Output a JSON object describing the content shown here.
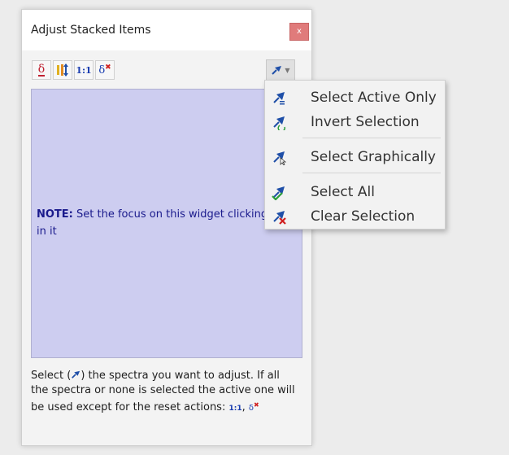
{
  "window": {
    "title": "Adjust Stacked Items",
    "close_label": "x"
  },
  "toolbar": {
    "buttons": [
      {
        "icon": "delta-underline-icon",
        "label": "δ"
      },
      {
        "icon": "align-stack-icon",
        "label": ""
      },
      {
        "icon": "one-to-one-icon",
        "label": "1:1"
      },
      {
        "icon": "delta-reset-icon",
        "label": "δ"
      }
    ],
    "pin_dropdown": {
      "icon": "pin-icon"
    }
  },
  "main": {
    "note_bold": "NOTE:",
    "note_text": " Set the focus on this widget clicking in it"
  },
  "help": {
    "part1": "Select (",
    "part2": ") the spectra you want to adjust. If all the spectra or none is selected the active one will be used except for the reset actions: ",
    "sym_one": "1:1",
    "comma": ", ",
    "sym_delta": "δ"
  },
  "menu": {
    "items": [
      {
        "label": "Select Active Only",
        "icon": "pin-active-icon"
      },
      {
        "label": "Invert Selection",
        "icon": "pin-invert-icon"
      },
      {
        "label": "Select Graphically",
        "icon": "pin-cursor-icon"
      },
      {
        "label": "Select All",
        "icon": "pin-check-icon"
      },
      {
        "label": "Clear Selection",
        "icon": "pin-clear-icon"
      }
    ]
  },
  "colors": {
    "spectra_bg": "#cdcdf0",
    "note_text": "#1a1a8c",
    "close_btn": "#e07b7b",
    "pin_blue": "#1f4fa8"
  }
}
